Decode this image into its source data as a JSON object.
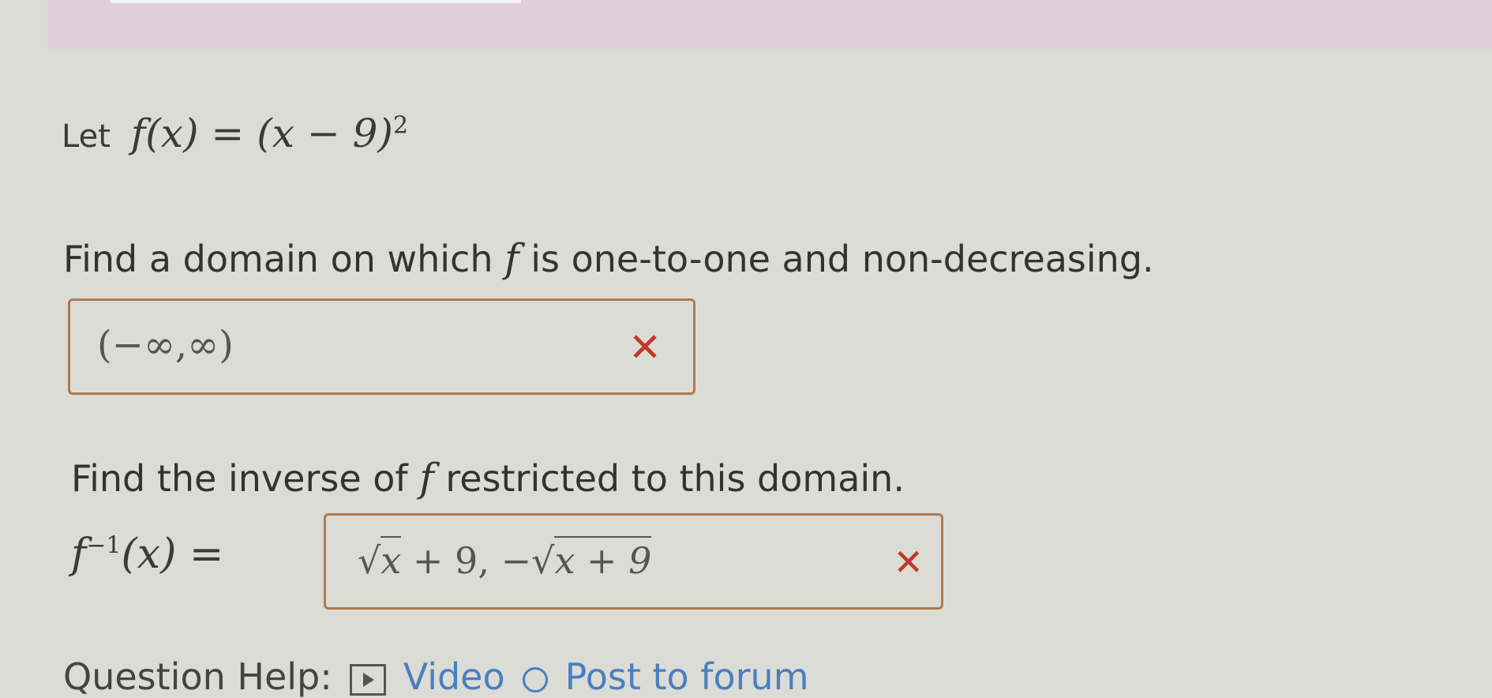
{
  "intro": {
    "label": "Let",
    "function_lhs": "f(x)",
    "equals": "=",
    "function_rhs": "(x − 9)",
    "exponent": "2"
  },
  "question1": {
    "text_before": "Find a domain on which",
    "symbol": "f",
    "text_after": "is one-to-one and non-decreasing.",
    "answer": "(−∞,∞)",
    "status_mark": "✕"
  },
  "question2": {
    "text_before": "Find the inverse of",
    "symbol": "f",
    "text_after": "restricted to this domain.",
    "inverse_label_base": "f",
    "inverse_label_exp": "−1",
    "inverse_label_arg": "(x)",
    "equals": "=",
    "answer_part1_radicand": "x",
    "answer_part1_rest": "+ 9,",
    "answer_part2_sign": "−",
    "answer_part2_radicand": "x + 9",
    "status_mark": "✕"
  },
  "help": {
    "label": "Question Help:",
    "video_label": "Video",
    "forum_label": "Post to forum"
  },
  "colors": {
    "background": "#dcdcd6",
    "banner": "#e2cfdc",
    "box_border": "#b07a4e",
    "error_mark": "#c0392b",
    "link": "#4a7fc1"
  }
}
